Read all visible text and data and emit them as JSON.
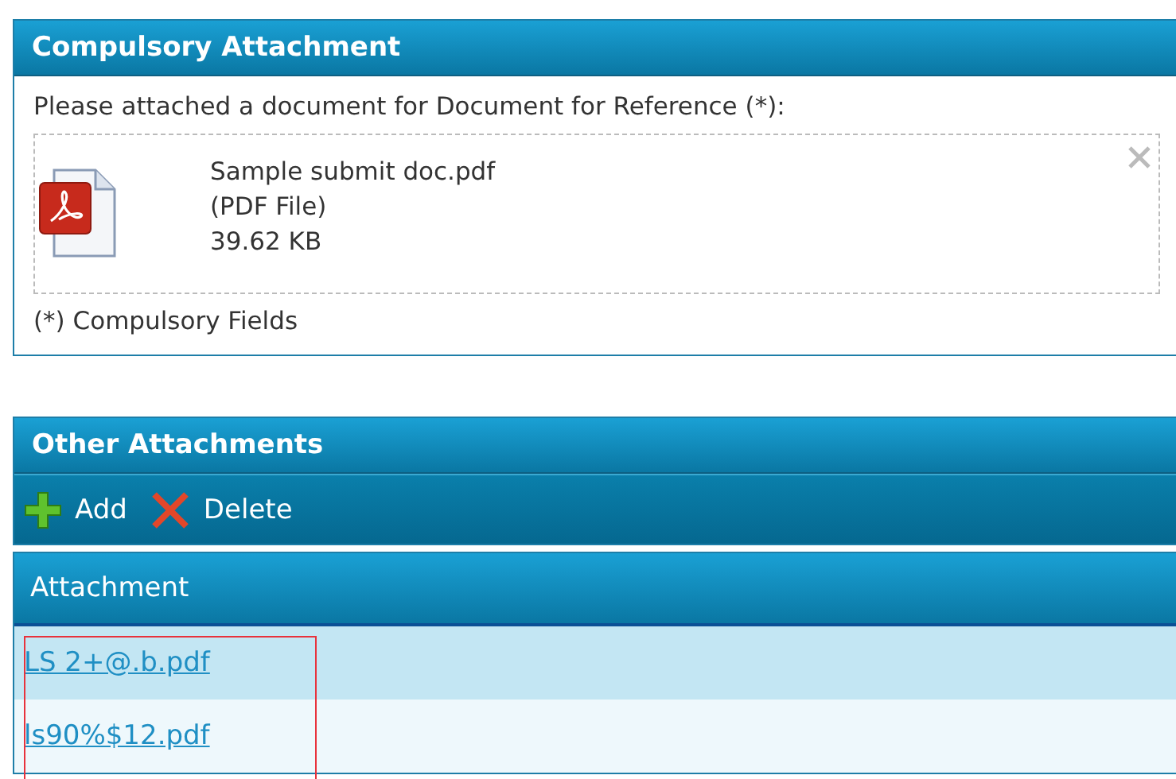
{
  "compulsory": {
    "title": "Compulsory Attachment",
    "prompt": "Please attached a document for Document for Reference (*):",
    "file": {
      "name": "Sample submit doc.pdf",
      "type": "(PDF File)",
      "size": "39.62 KB"
    },
    "footnote": "(*) Compulsory Fields"
  },
  "other": {
    "title": "Other Attachments",
    "toolbar": [
      {
        "kind": "add",
        "label": "Add"
      },
      {
        "kind": "delete",
        "label": "Delete"
      }
    ],
    "columns": [
      "Attachment"
    ],
    "rows": [
      {
        "file": "LS 2+@.b.pdf",
        "selected": true
      },
      {
        "file": "ls90%$12.pdf",
        "selected": false
      }
    ]
  }
}
